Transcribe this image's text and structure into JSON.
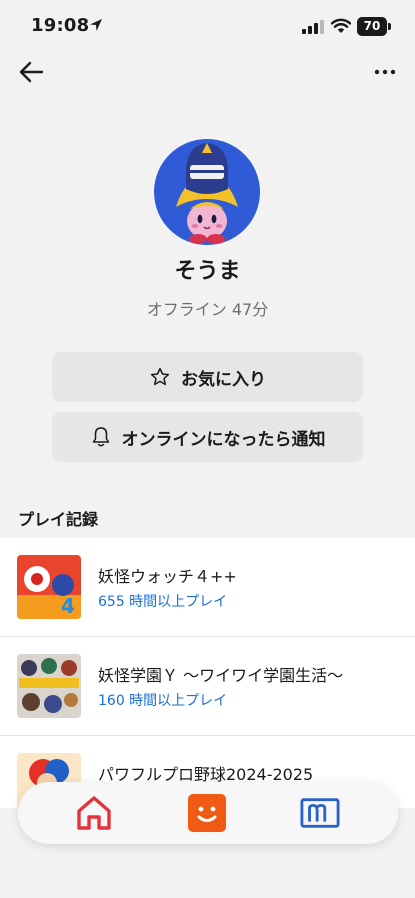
{
  "status_bar": {
    "time": "19:08",
    "battery": "70"
  },
  "nav": {
    "back_icon": "arrow-left-icon",
    "more_icon": "more-horizontal-icon"
  },
  "profile": {
    "name": "そうま",
    "status": "オフライン 47分",
    "avatar_description_colors": {
      "background": "#2f5bd6",
      "accent": "#f2b6d2"
    }
  },
  "actions": {
    "favorite_label": "お気に入り",
    "favorite_icon": "star-outline-icon",
    "notify_label": "オンラインになったら通知",
    "notify_icon": "bell-icon"
  },
  "play_records": {
    "title": "プレイ記録",
    "items": [
      {
        "title": "妖怪ウォッチ４++",
        "time": "655 時間以上プレイ"
      },
      {
        "title": "妖怪学園Ｙ 〜ワイワイ学園生活〜",
        "time": "160 時間以上プレイ"
      },
      {
        "title": "パワフルプロ野球2024-2025",
        "time": ""
      }
    ]
  },
  "tab_bar": {
    "home_color": "#e5333c",
    "friends_color": "#f05a14",
    "news_color": "#2b62c8"
  }
}
